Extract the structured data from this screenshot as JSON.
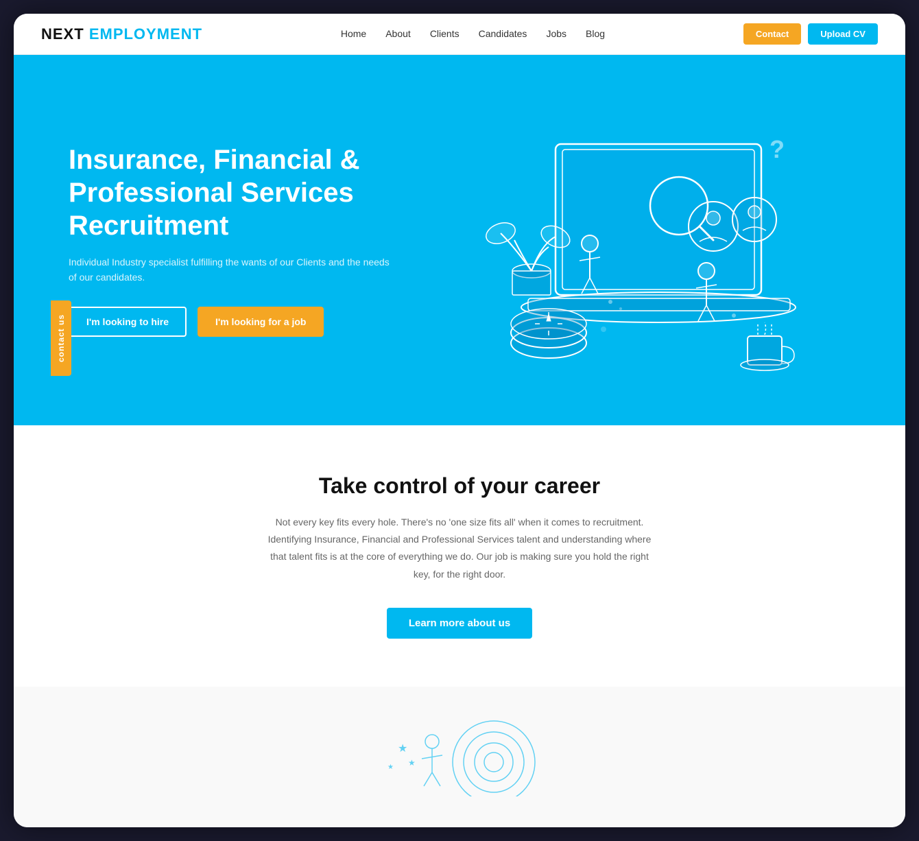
{
  "brand": {
    "next": "NEXT",
    "employment": "EMPLOYMENT"
  },
  "nav": {
    "links": [
      "Home",
      "About",
      "Clients",
      "Candidates",
      "Jobs",
      "Blog"
    ],
    "contact_btn": "Contact",
    "upload_btn": "Upload CV"
  },
  "hero": {
    "title": "Insurance, Financial & Professional Services Recruitment",
    "subtitle": "Individual Industry specialist fulfilling the wants of our Clients and the needs of our candidates.",
    "btn_hire": "I'm looking to hire",
    "btn_job": "I'm looking for a job"
  },
  "contact_tab": "contact us",
  "career_section": {
    "title": "Take control of your career",
    "description": "Not every key fits every hole. There's no 'one size fits all' when it comes to recruitment. Identifying Insurance, Financial and Professional Services talent and understanding where that talent fits is at the core of everything we do. Our job is making sure you hold the right key, for the right door.",
    "btn_learn": "Learn more about us"
  },
  "colors": {
    "primary": "#00b8f0",
    "accent": "#f5a623",
    "dark": "#111111",
    "white": "#ffffff"
  }
}
